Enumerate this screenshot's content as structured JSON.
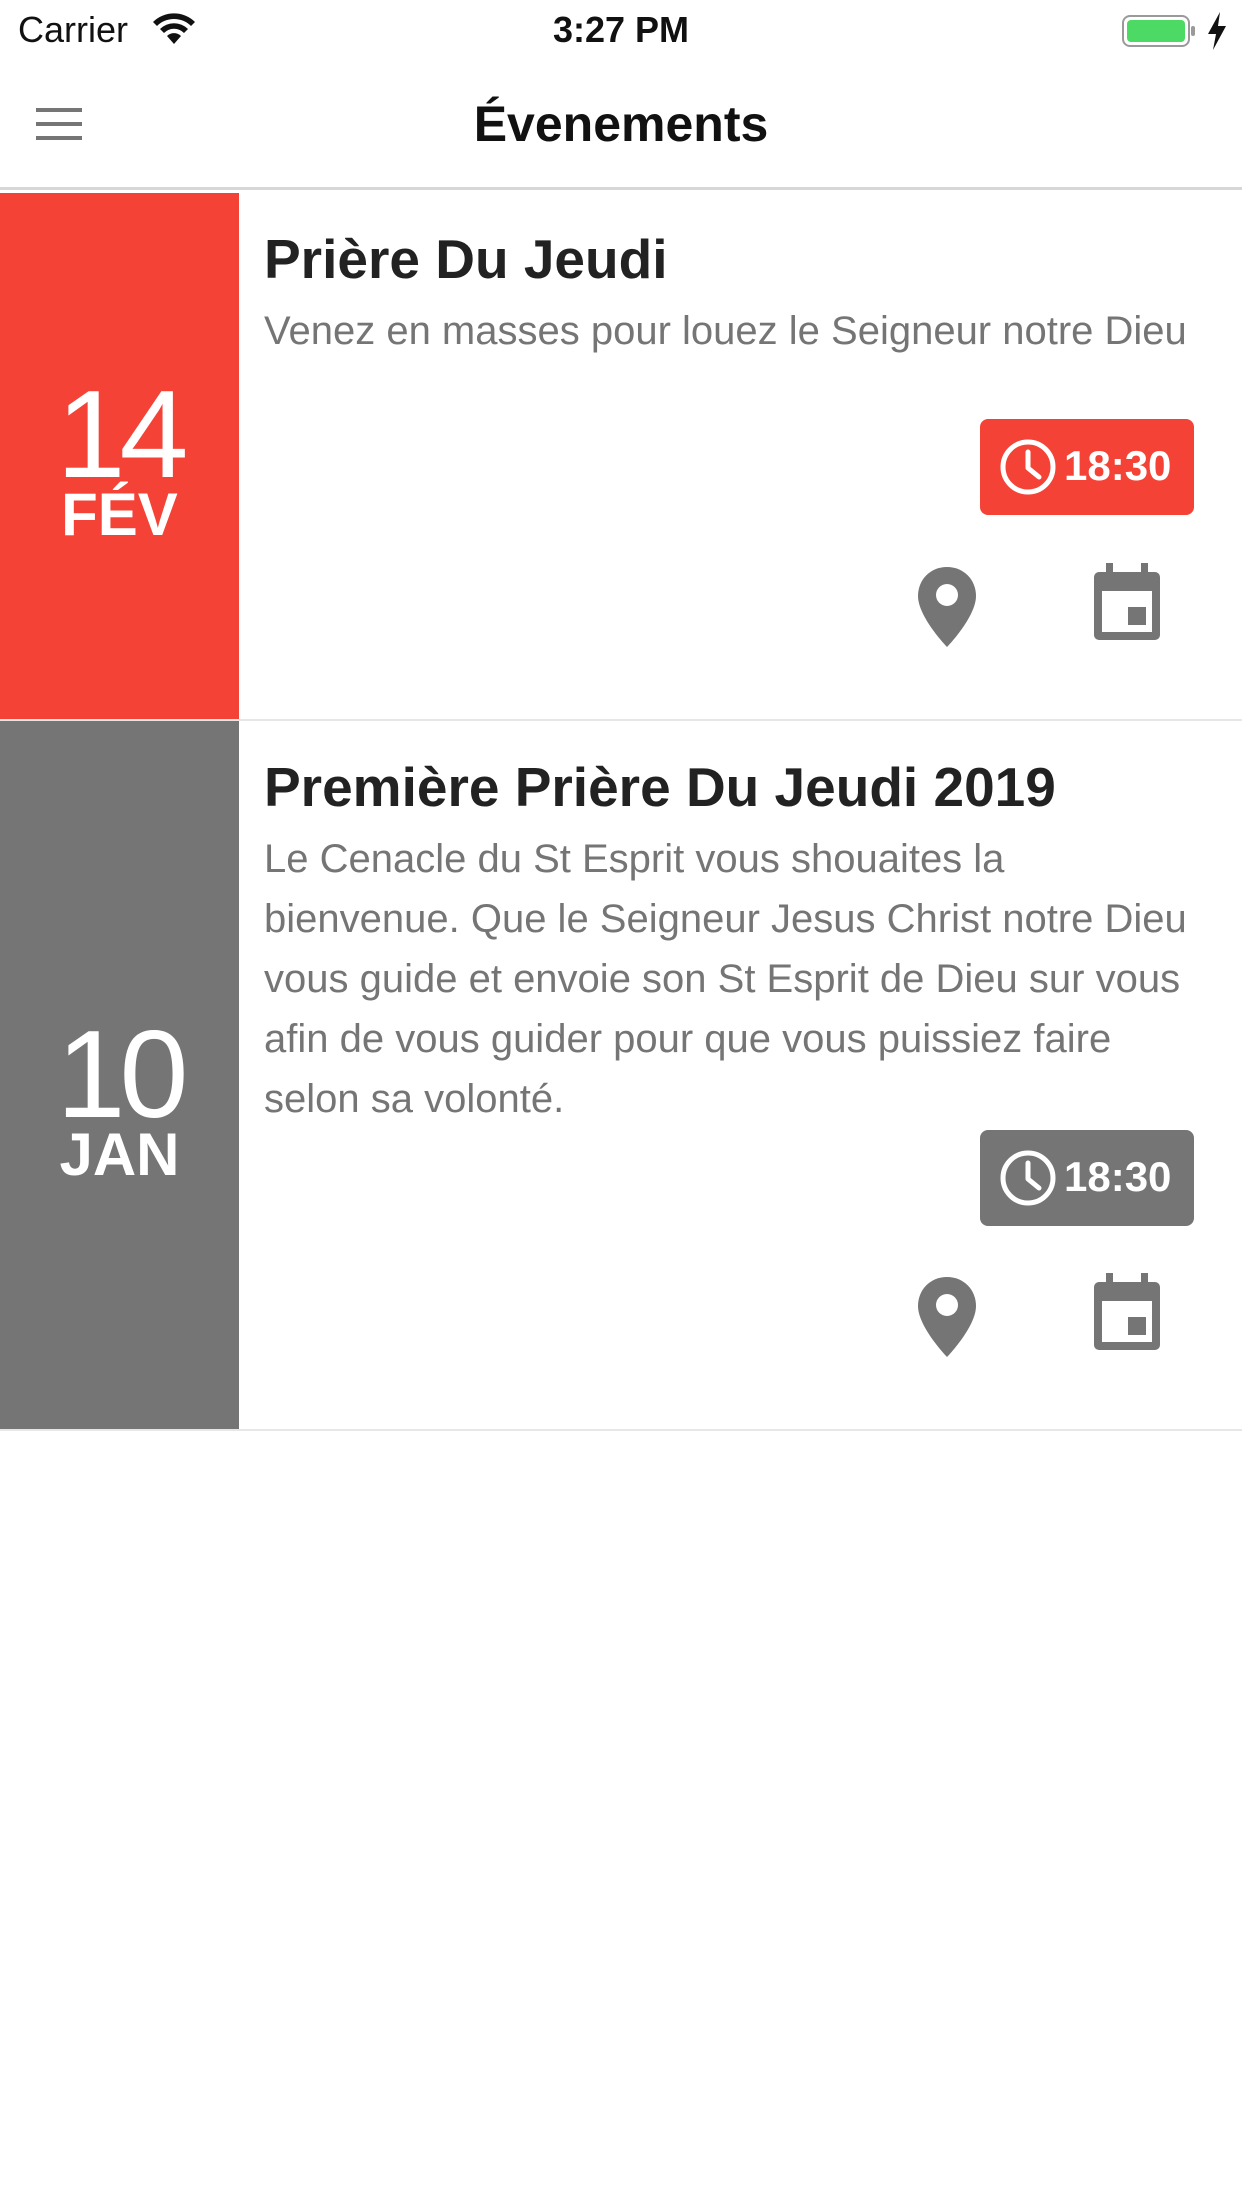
{
  "status_bar": {
    "carrier": "Carrier",
    "time": "3:27 PM"
  },
  "nav": {
    "title": "Évenements",
    "menu_icon": "hamburger-menu-icon"
  },
  "colors": {
    "accent_red": "#f44336",
    "past_grey": "#757575",
    "battery_green": "#4cd964"
  },
  "events": [
    {
      "day": "14",
      "month": "FÉV",
      "title": "Prière Du Jeudi",
      "description": "Venez en masses pour louez le Seigneur notre Dieu",
      "time": "18:30",
      "color": "#f44336"
    },
    {
      "day": "10",
      "month": "JAN",
      "title": "Première Prière Du Jeudi 2019",
      "description": "Le Cenacle du St Esprit vous shouaites la bienvenue. Que le Seigneur Jesus Christ notre Dieu vous guide et envoie son St Esprit de Dieu sur vous afin de vous guider pour que vous puissiez faire selon sa volonté.",
      "time": "18:30",
      "color": "#757575"
    }
  ]
}
